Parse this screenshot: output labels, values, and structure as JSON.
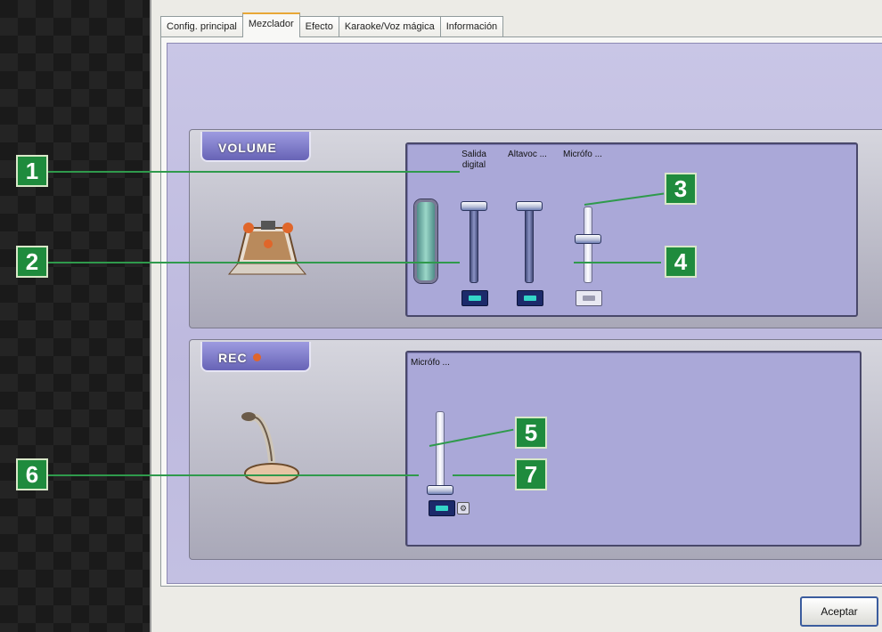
{
  "tabs": [
    {
      "label": "Config. principal"
    },
    {
      "label": "Mezclador"
    },
    {
      "label": "Efecto"
    },
    {
      "label": "Karaoke/Voz mágica"
    },
    {
      "label": "Información"
    }
  ],
  "active_tab": "Mezclador",
  "play_section": {
    "label": "VOLUME",
    "columns": [
      {
        "label": "Salida digital",
        "level": 1.0,
        "muted": false
      },
      {
        "label": "Altavoc ...",
        "level": 1.0,
        "muted": false
      },
      {
        "label": "Micrófo ...",
        "level": 0.55,
        "muted": true
      }
    ]
  },
  "rec_section": {
    "label": "REC",
    "columns": [
      {
        "label": "Micrófo ...",
        "level": 0.0,
        "muted": false
      }
    ]
  },
  "callouts": [
    "1",
    "2",
    "3",
    "4",
    "5",
    "6",
    "7"
  ],
  "footer": {
    "ok_label": "Aceptar"
  },
  "colors": {
    "callout": "#1f8b3d",
    "panel": "#bdb9de",
    "rec_dot": "#e0652c",
    "accent_button": "#34d6c8"
  },
  "icons": [
    "speaker-stage-icon",
    "microphone-icon",
    "rec-dot-icon",
    "mute-toggle-icon",
    "input-select-icon"
  ]
}
